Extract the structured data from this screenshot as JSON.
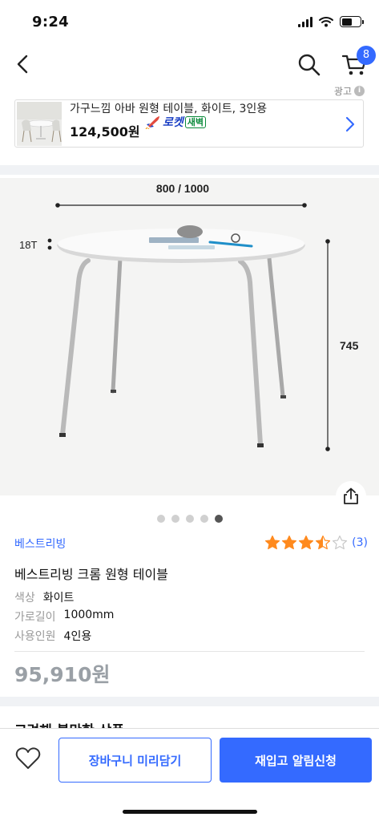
{
  "status_bar": {
    "time": "9:24"
  },
  "header": {
    "cart_count": "8"
  },
  "ad": {
    "label": "광고",
    "title": "가구느낌 아바 원형 테이블, 화이트, 3인용",
    "price": "124,500원",
    "rocket_label": "로켓",
    "delivery_tag": "새벽"
  },
  "product_image": {
    "width_label": "800 / 1000",
    "thickness_label": "18T",
    "height_label": "745",
    "dots_total": 5,
    "dots_active_index": 4
  },
  "product": {
    "brand": "베스트리빙",
    "rating": 3.5,
    "rating_max": 5,
    "review_count": "(3)",
    "name": "베스트리빙 크롬 원형 테이블",
    "options": [
      {
        "label": "색상",
        "value": "화이트"
      },
      {
        "label": "가로길이",
        "value": "1000mm"
      },
      {
        "label": "사용인원",
        "value": "4인용"
      }
    ],
    "price": "95,910원"
  },
  "section": {
    "title": "고려해 볼만한 상품"
  },
  "bottom_bar": {
    "cart_button": "장바구니 미리담기",
    "notify_button": "재입고 알림신청"
  },
  "colors": {
    "accent": "#346aff",
    "star": "#ff8a1e",
    "rocket_green": "#0a8a3a"
  }
}
